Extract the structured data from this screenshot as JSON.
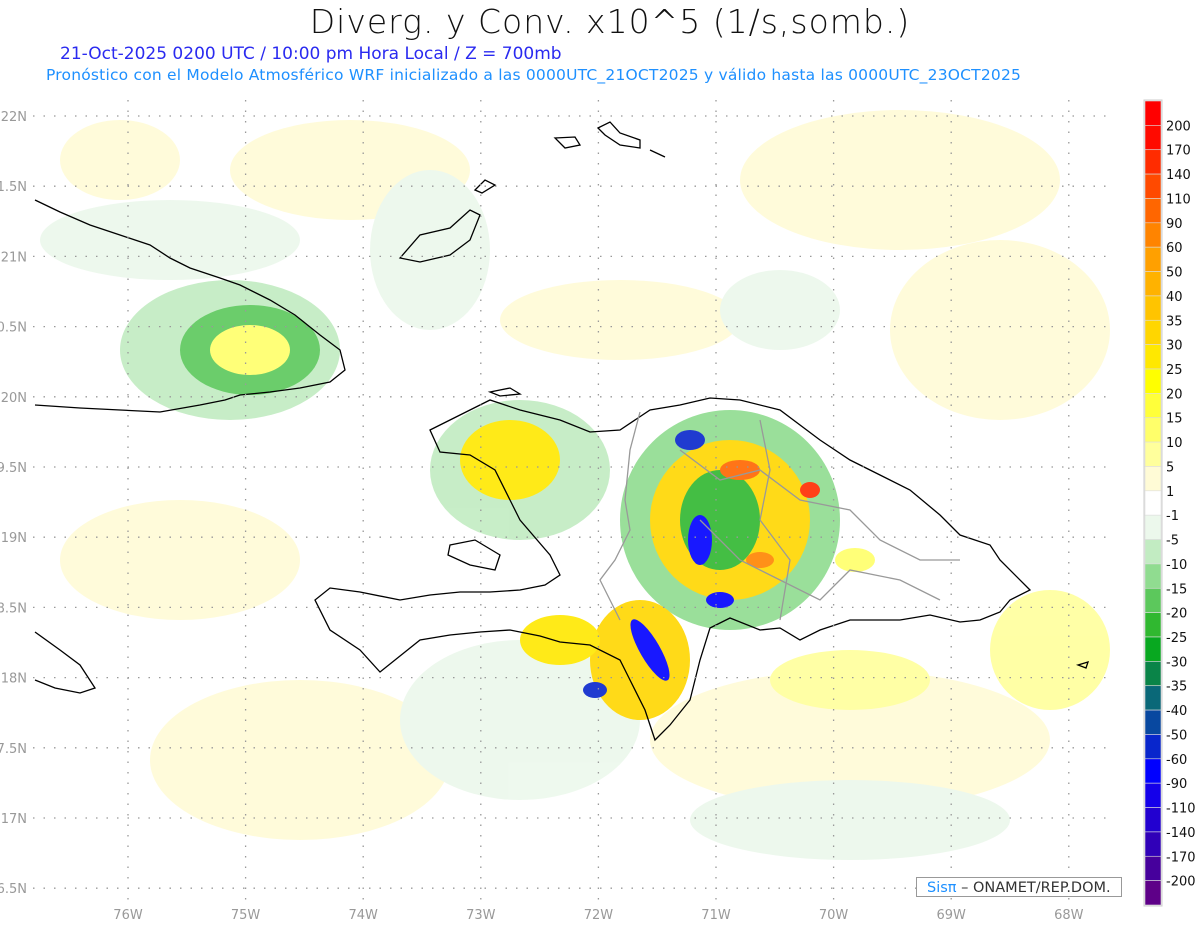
{
  "header": {
    "title": "Diverg. y Conv. x10^5 (1/s,somb.)",
    "subtitle": "21-Oct-2025  0200 UTC / 10:00 pm Hora Local / Z = 700mb",
    "model_line": "Pronóstico con el Modelo Atmosférico WRF inicializado a las 0000UTC_21OCT2025 y válido hasta las  0000UTC_23OCT2025"
  },
  "axes": {
    "lat_labels": [
      {
        "value": 22,
        "label": "22N"
      },
      {
        "value": 21.5,
        "label": "1.5N"
      },
      {
        "value": 21,
        "label": "21N"
      },
      {
        "value": 20.5,
        "label": "0.5N"
      },
      {
        "value": 20,
        "label": "20N"
      },
      {
        "value": 19.5,
        "label": "9.5N"
      },
      {
        "value": 19,
        "label": "19N"
      },
      {
        "value": 18.5,
        "label": "8.5N"
      },
      {
        "value": 18,
        "label": "18N"
      },
      {
        "value": 17.5,
        "label": "7.5N"
      },
      {
        "value": 17,
        "label": "17N"
      },
      {
        "value": 16.5,
        "label": "6.5N"
      }
    ],
    "lon_labels": [
      {
        "value": -76,
        "label": "76W"
      },
      {
        "value": -75,
        "label": "75W"
      },
      {
        "value": -74,
        "label": "74W"
      },
      {
        "value": -73,
        "label": "73W"
      },
      {
        "value": -72,
        "label": "72W"
      },
      {
        "value": -71,
        "label": "71W"
      },
      {
        "value": -70,
        "label": "70W"
      },
      {
        "value": -69,
        "label": "69W"
      },
      {
        "value": -68,
        "label": "68W"
      }
    ]
  },
  "colorbar": {
    "labels": [
      "200",
      "170",
      "140",
      "110",
      "90",
      "60",
      "50",
      "40",
      "35",
      "30",
      "25",
      "20",
      "15",
      "10",
      "5",
      "1",
      "-1",
      "-5",
      "-10",
      "-15",
      "-20",
      "-25",
      "-30",
      "-35",
      "-40",
      "-50",
      "-60",
      "-90",
      "-110",
      "-140",
      "-170",
      "-200"
    ],
    "colors": [
      "#ff0000",
      "#ff0a00",
      "#ff2c00",
      "#ff4a00",
      "#ff6600",
      "#ff8400",
      "#ffa000",
      "#ffb200",
      "#ffc400",
      "#ffd600",
      "#ffe800",
      "#ffff00",
      "#ffff3a",
      "#ffff6a",
      "#ffff9c",
      "#fffbd6",
      "#ffffff",
      "#ecf8ec",
      "#c2ecc2",
      "#90dc90",
      "#5cc85c",
      "#30b830",
      "#08a820",
      "#0a8448",
      "#0a6878",
      "#0848a0",
      "#0826cc",
      "#0000ff",
      "#1400ea",
      "#2200d0",
      "#3000b8",
      "#46009c",
      "#5e0088"
    ]
  },
  "watermark": {
    "brand": "Sisπ",
    "text": " – ONAMET/REP.DOM."
  }
}
